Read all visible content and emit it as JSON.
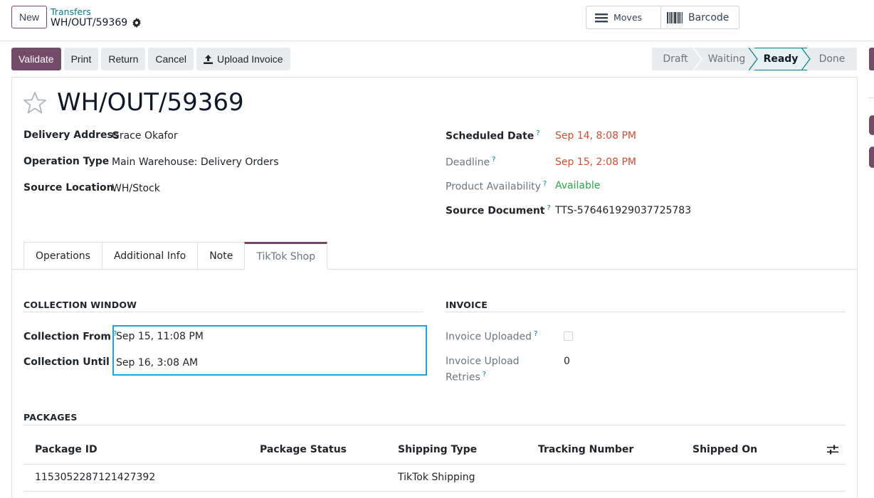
{
  "header": {
    "new_label": "New",
    "breadcrumb": "Transfers",
    "record": "WH/OUT/59369",
    "moves_label": "Moves",
    "barcode_label": "Barcode"
  },
  "actions": {
    "validate": "Validate",
    "print": "Print",
    "return": "Return",
    "cancel": "Cancel",
    "upload_invoice": "Upload Invoice"
  },
  "status": {
    "stages": [
      "Draft",
      "Waiting",
      "Ready",
      "Done"
    ],
    "current": "Ready"
  },
  "form": {
    "title": "WH/OUT/59369",
    "left": {
      "delivery_address_label": "Delivery Address",
      "delivery_address": "Grace Okafor",
      "operation_type_label": "Operation Type",
      "operation_type": "Main Warehouse: Delivery Orders",
      "source_location_label": "Source Location",
      "source_location": "WH/Stock"
    },
    "right": {
      "scheduled_date_label": "Scheduled Date",
      "scheduled_date": "Sep 14, 8:08 PM",
      "deadline_label": "Deadline",
      "deadline": "Sep 15, 2:08 PM",
      "availability_label": "Product Availability",
      "availability": "Available",
      "source_document_label": "Source Document",
      "source_document": "TTS-576461929037725783"
    },
    "help_mark": "?"
  },
  "tabs": [
    "Operations",
    "Additional Info",
    "Note",
    "TikTok Shop"
  ],
  "tiktok": {
    "collection_window_title": "COLLECTION WINDOW",
    "collection_from_label": "Collection From",
    "collection_from": "Sep 15, 11:08 PM",
    "collection_until_label": "Collection Until",
    "collection_until": "Sep 16, 3:08 AM",
    "invoice_title": "INVOICE",
    "invoice_uploaded_label": "Invoice Uploaded",
    "invoice_uploaded": false,
    "invoice_retries_label_1": "Invoice Upload",
    "invoice_retries_label_2": "Retries",
    "invoice_retries": "0",
    "packages_title": "PACKAGES",
    "columns": [
      "Package ID",
      "Package Status",
      "Shipping Type",
      "Tracking Number",
      "Shipped On"
    ],
    "rows": [
      {
        "package_id": "1153052287121427392",
        "package_status": "",
        "shipping_type": "TikTok Shipping",
        "tracking_number": "",
        "shipped_on": ""
      }
    ]
  },
  "colors": {
    "primary": "#714b67",
    "link": "#017e84",
    "danger": "#d44c31",
    "success": "#28a745",
    "focus": "#1aa3e8"
  },
  "icons": [
    "gear-icon",
    "list-icon",
    "barcode-icon",
    "upload-icon",
    "star-icon",
    "column-settings-icon"
  ]
}
